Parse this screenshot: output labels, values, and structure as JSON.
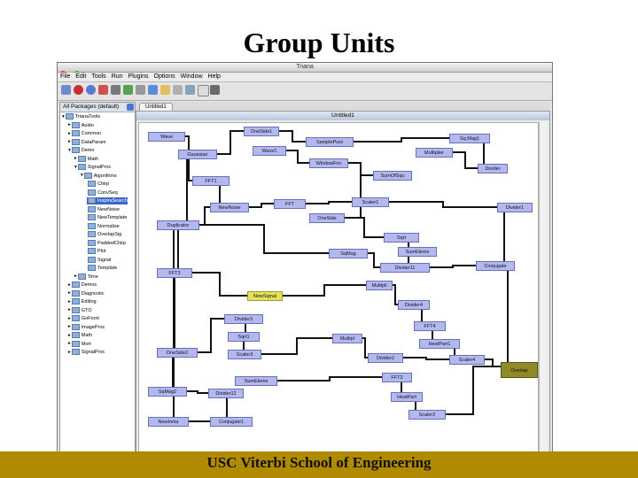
{
  "slide": {
    "title": "Group Units",
    "footer": "USC Viterbi School of Engineering",
    "colors": {
      "footer_bar": "#b08a00",
      "unit_fill": "#b3b8ee",
      "highlight_unit": "#e4e25a",
      "output_unit": "#8f8a28"
    }
  },
  "app": {
    "window_title": "Triana",
    "menu": [
      "File",
      "Edit",
      "Tools",
      "Run",
      "Plugins",
      "Options",
      "Window",
      "Help"
    ],
    "toolbar_icons": [
      "new-icon",
      "open-icon",
      "save-icon",
      "stop-icon",
      "run-icon",
      "pause-icon",
      "group-icon",
      "ungroup-icon",
      "cut-icon",
      "copy-icon",
      "paste-icon",
      "delete-icon",
      "print-icon",
      "zoom-icon",
      "help-icon"
    ],
    "package_selector": "All Packages (default)",
    "tab_label": "Untitled1",
    "inner_window_title": "Untitled1",
    "tree": [
      {
        "label": "TrianaTools",
        "depth": 0,
        "expanded": true
      },
      {
        "label": "Audio",
        "depth": 1
      },
      {
        "label": "Common",
        "depth": 1
      },
      {
        "label": "DataParam",
        "depth": 1
      },
      {
        "label": "Demo",
        "depth": 1,
        "expanded": true
      },
      {
        "label": "Math",
        "depth": 2
      },
      {
        "label": "SignalProc",
        "depth": 2,
        "expanded": true
      },
      {
        "label": "Algorithms",
        "depth": 3,
        "expanded": true
      },
      {
        "label": "Chirp",
        "depth": 4
      },
      {
        "label": "ConvSeq",
        "depth": 4
      },
      {
        "label": "InspiraSearch",
        "depth": 4,
        "selected": true
      },
      {
        "label": "NewNoise",
        "depth": 4
      },
      {
        "label": "NewTemplate",
        "depth": 4
      },
      {
        "label": "Normalise",
        "depth": 4
      },
      {
        "label": "OverlapSig",
        "depth": 4
      },
      {
        "label": "PaddedChirp",
        "depth": 4
      },
      {
        "label": "Plot",
        "depth": 4
      },
      {
        "label": "Signal",
        "depth": 4
      },
      {
        "label": "Template",
        "depth": 4
      },
      {
        "label": "Time",
        "depth": 2
      },
      {
        "label": "Demos",
        "depth": 1
      },
      {
        "label": "Diagnostic",
        "depth": 1
      },
      {
        "label": "Editing",
        "depth": 1
      },
      {
        "label": "GTO",
        "depth": 1
      },
      {
        "label": "GoFront",
        "depth": 1
      },
      {
        "label": "ImageProc",
        "depth": 1
      },
      {
        "label": "Math",
        "depth": 1
      },
      {
        "label": "Mort",
        "depth": 1
      },
      {
        "label": "SignalProc",
        "depth": 1
      }
    ],
    "units": [
      "Wave",
      "Gaussian",
      "FFT1",
      "OneSide1",
      "Wave1",
      "SamplePure",
      "WindowFnc",
      "Sq.Mag1",
      "Multiplier",
      "SumOfSqu",
      "Divider",
      "NewNoise",
      "FFT",
      "Scaler1",
      "OneSide",
      "Divider1",
      "Duplicator",
      "Sqrt",
      "SumElems",
      "SqMag",
      "Divider11",
      "Conjugate",
      "FFT3",
      "NewSignal",
      "Multipli",
      "Divider4",
      "FFT4",
      "HeatPart1",
      "Divider3",
      "Sqrt1",
      "Scaler3",
      "OneSide2",
      "Multipl",
      "Divider2",
      "Scaler4",
      "Overlap",
      "SumElems",
      "FFT2",
      "SqMag2",
      "Divider12",
      "HeatPart",
      "Newtonia",
      "Conjugate1",
      "Scaler2"
    ]
  }
}
